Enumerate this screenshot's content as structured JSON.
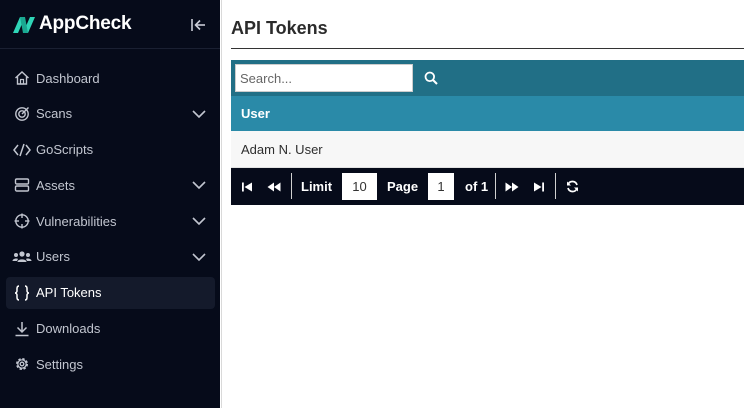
{
  "app": {
    "name": "AppCheck"
  },
  "sidebar": {
    "items": [
      {
        "label": "Dashboard",
        "icon": "home-icon",
        "has_submenu": false,
        "active": false
      },
      {
        "label": "Scans",
        "icon": "target-icon",
        "has_submenu": true,
        "active": false
      },
      {
        "label": "GoScripts",
        "icon": "code-icon",
        "has_submenu": false,
        "active": false
      },
      {
        "label": "Assets",
        "icon": "server-icon",
        "has_submenu": true,
        "active": false
      },
      {
        "label": "Vulnerabilities",
        "icon": "crosshair-icon",
        "has_submenu": true,
        "active": false
      },
      {
        "label": "Users",
        "icon": "users-icon",
        "has_submenu": true,
        "active": false
      },
      {
        "label": "API Tokens",
        "icon": "braces-icon",
        "has_submenu": false,
        "active": true
      },
      {
        "label": "Downloads",
        "icon": "download-icon",
        "has_submenu": false,
        "active": false
      },
      {
        "label": "Settings",
        "icon": "gear-icon",
        "has_submenu": false,
        "active": false
      }
    ]
  },
  "main": {
    "title": "API Tokens",
    "search": {
      "placeholder": "Search...",
      "value": ""
    },
    "table": {
      "columns": [
        "User"
      ],
      "rows": [
        [
          "Adam N. User"
        ]
      ]
    },
    "pager": {
      "limit_label": "Limit",
      "limit_value": "10",
      "page_label": "Page",
      "page_value": "1",
      "of_label": "of 1"
    }
  },
  "colors": {
    "sidebar_bg": "#060b1a",
    "accent": "#2fd6b8",
    "search_bar": "#216f86",
    "table_header": "#2a8aa8"
  }
}
